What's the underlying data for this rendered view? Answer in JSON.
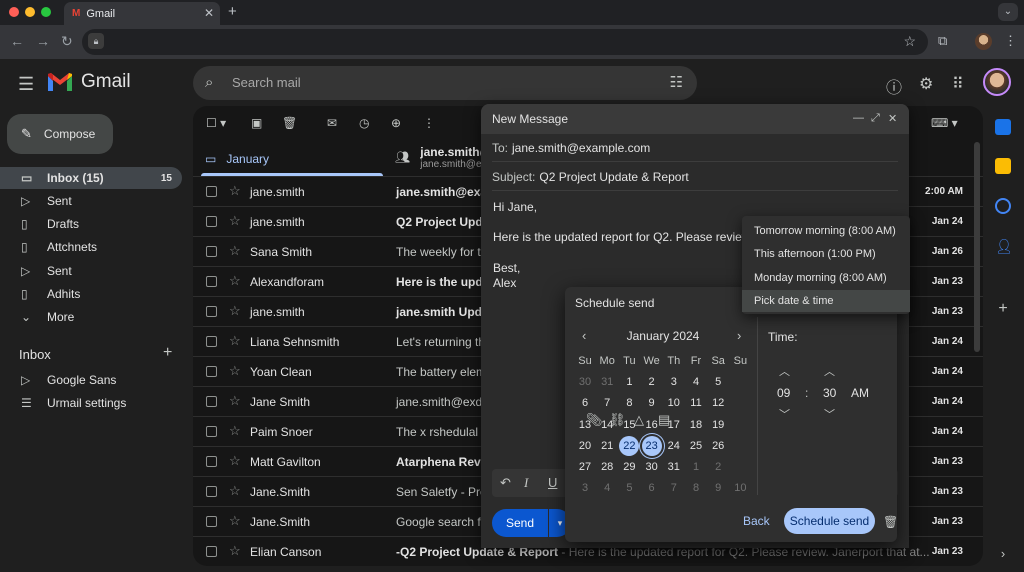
{
  "browser": {
    "tab_title": "Gmail",
    "tab_logo": "M",
    "new_tab": "+",
    "menu": "⌄"
  },
  "header": {
    "app_name": "Gmail",
    "search_placeholder": "Search mail"
  },
  "sidebar": {
    "compose_label": "Compose",
    "items": [
      {
        "label": "Inbox (15)",
        "count": "15",
        "icon": "inbox-icon"
      },
      {
        "label": "Sent",
        "icon": "send-icon"
      },
      {
        "label": "Drafts",
        "icon": "draft-icon"
      },
      {
        "label": "Attchnets",
        "icon": "draft-icon"
      },
      {
        "label": "Sent",
        "icon": "send-icon"
      },
      {
        "label": "Adhits",
        "icon": "draft-icon"
      },
      {
        "label": "More",
        "icon": "chevron-down-icon"
      }
    ],
    "labels_heading": "Inbox",
    "labels": [
      {
        "label": "Google Sans",
        "icon": "label-icon"
      },
      {
        "label": "Urmail settings",
        "icon": "list-icon"
      }
    ]
  },
  "mail": {
    "primary_tab": "January",
    "second_tab_line1": "jane.smith@",
    "second_tab_line2": "jane.smith@ex",
    "rows": [
      {
        "sender": "jane.smith",
        "subject": "jane.smith@exar",
        "date": "2:00 AM",
        "unread": true
      },
      {
        "sender": "jane.smith",
        "subject": "Q2 Project Upda",
        "date": "Jan 24",
        "unread": true
      },
      {
        "sender": "Sana Smith",
        "subject": "The weekly for t",
        "date": "Jan 26",
        "unread": false
      },
      {
        "sender": "Alexandforam",
        "subject": "Here is the upda",
        "date": "Jan 23",
        "unread": true
      },
      {
        "sender": "jane.smith",
        "subject": "jane.smith Upda",
        "date": "Jan 23",
        "unread": true
      },
      {
        "sender": "Liana Sehnsmith",
        "subject": "Let's returning th",
        "date": "Jan 24",
        "unread": false
      },
      {
        "sender": "Yoan Clean",
        "subject": "The battery elema",
        "date": "Jan 24",
        "unread": false
      },
      {
        "sender": "Jane Smith",
        "subject": "jane.smith@exda",
        "date": "Jan 24",
        "unread": false
      },
      {
        "sender": "Paim Snoer",
        "subject": "The x rshedulal a",
        "date": "Jan 24",
        "unread": false
      },
      {
        "sender": "Matt Gavilton",
        "subject": "Atarphena Reve",
        "date": "Jan 23",
        "unread": true
      },
      {
        "sender": "Jane.Smith",
        "subject": "Sen Saletfy - Prer",
        "date": "Jan 23",
        "unread": false
      },
      {
        "sender": "Jane.Smith",
        "subject": "Google search fro",
        "date": "Jan 23",
        "unread": false
      },
      {
        "sender": "Elian Canson",
        "subject": "-Q2 Project Update & Report",
        "snippet": " - Here is the updated report for Q2. Please review. Janerport that at...",
        "date": "Jan 23",
        "unread": true
      }
    ]
  },
  "compose": {
    "title": "New Message",
    "to_label": "To:",
    "to_value": "jane.smith@example.com",
    "subject_label": "Subject:",
    "subject_value": "Q2 Project Update & Report",
    "body": [
      "Hi Jane,",
      "Here is the updated report for Q2. Please review.",
      "Best,",
      "Alex"
    ],
    "send_label": "Send"
  },
  "quick_options": [
    "Tomorrow morning (8:00 AM)",
    "This afternoon (1:00 PM)",
    "Monday morning (8:00 AM)",
    "Pick date & time"
  ],
  "schedule": {
    "title": "Schedule send",
    "month_label": "January 2024",
    "weekdays": [
      "Su",
      "Mo",
      "Tu",
      "We",
      "Th",
      "Fr",
      "Sa",
      "Su"
    ],
    "weeks": [
      [
        "30",
        "31",
        "1",
        "2",
        "3",
        "4",
        "5"
      ],
      [
        "6",
        "7",
        "8",
        "9",
        "10",
        "11",
        "12"
      ],
      [
        "13",
        "14",
        "15",
        "16",
        "17",
        "18",
        "19"
      ],
      [
        "20",
        "21",
        "22",
        "23",
        "24",
        "25",
        "26"
      ],
      [
        "27",
        "28",
        "29",
        "30",
        "31",
        "1",
        "2"
      ],
      [
        "3",
        "4",
        "5",
        "6",
        "7",
        "8",
        "9",
        "10"
      ]
    ],
    "selected_days": [
      "22",
      "23"
    ],
    "time_label": "Time:",
    "hour": "09",
    "separator": ":",
    "minute": "30",
    "ampm": "AM",
    "back_label": "Back",
    "confirm_label": "Schedule send"
  },
  "colors": {
    "accent": "#a8c7fa",
    "send_blue": "#0b57d0",
    "background": "#1f1f1f"
  }
}
